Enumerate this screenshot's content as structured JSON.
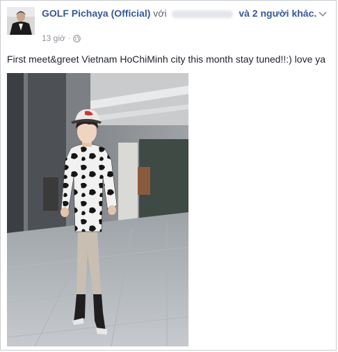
{
  "post": {
    "author": "GOLF Pichaya (Official)",
    "with_word": "với",
    "others_text": "và 2 người khác.",
    "timestamp": "13 giờ",
    "separator": "·",
    "privacy_icon": "globe-icon",
    "menu_icon": "chevron-down-icon",
    "caption": "First meet&greet Vietnam HoChiMinh city this month stay tuned!!:) love ya"
  },
  "colors": {
    "link": "#365899",
    "meta": "#90949c",
    "text": "#1d2129",
    "border": "#c9ccd1"
  }
}
